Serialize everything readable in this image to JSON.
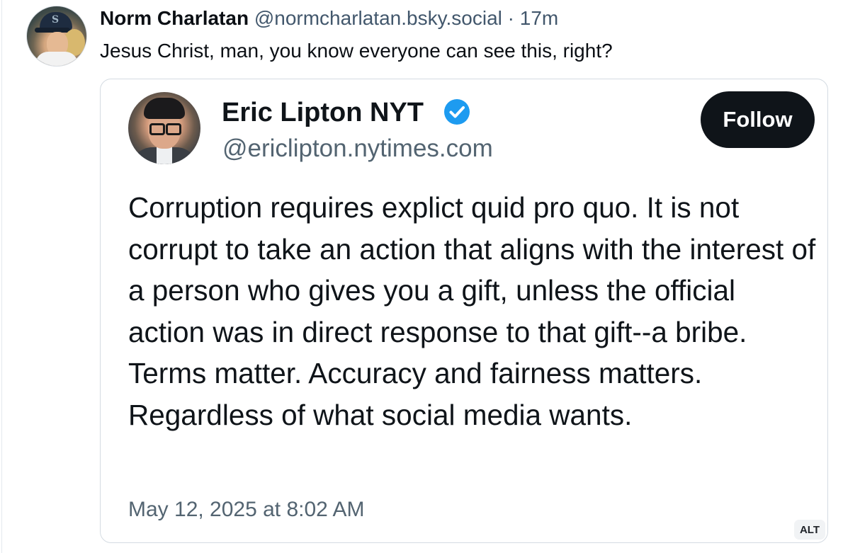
{
  "post": {
    "author_name": "Norm Charlatan",
    "author_handle": "@normcharlatan.bsky.social",
    "separator": "·",
    "time": "17m",
    "text": "Jesus Christ, man, you know everyone can see this, right?"
  },
  "embed": {
    "name": "Eric Lipton NYT",
    "handle": "@ericlipton.nytimes.com",
    "verified": true,
    "follow_label": "Follow",
    "body": "Corruption requires explict quid pro quo. It is not corrupt to take an action that aligns with the interest of a person who gives you a gift, unless the official action was in direct response to that gift--a bribe. Terms matter. Accuracy and fairness matters. Regardless of what social media wants.",
    "date": "May 12, 2025 at 8:02 AM",
    "alt_badge": "ALT"
  },
  "colors": {
    "verified_blue": "#1d9bf0",
    "follow_bg": "#0f1419",
    "muted_text": "#536471"
  }
}
